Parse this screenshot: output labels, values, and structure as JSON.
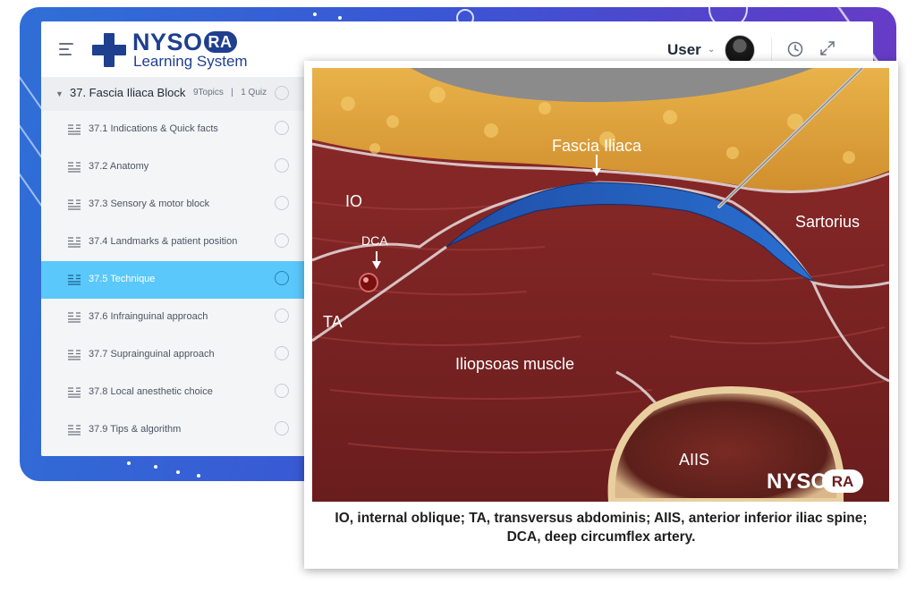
{
  "app": {
    "logo_brand": "NYSO",
    "logo_brand_ra": "RA",
    "logo_subtitle": "Learning System",
    "user_label": "User"
  },
  "sidebar": {
    "section": {
      "title": "37. Fascia Iliaca Block",
      "topics": "9Topics",
      "separator": "|",
      "quiz": "1 Quiz"
    },
    "items": [
      {
        "label": "37.1 Indications & Quick facts",
        "active": false
      },
      {
        "label": "37.2 Anatomy",
        "active": false
      },
      {
        "label": "37.3 Sensory & motor block",
        "active": false
      },
      {
        "label": "37.4 Landmarks & patient position",
        "active": false
      },
      {
        "label": "37.5 Technique",
        "active": true
      },
      {
        "label": "37.6 Infrainguinal approach",
        "active": false
      },
      {
        "label": "37.7 Suprainguinal approach",
        "active": false
      },
      {
        "label": "37.8 Local anesthetic choice",
        "active": false
      },
      {
        "label": "37.9 Tips & algorithm",
        "active": false
      }
    ]
  },
  "figure": {
    "labels": {
      "fascia_iliaca": "Fascia Iliaca",
      "io": "IO",
      "dca": "DCA",
      "ta": "TA",
      "sartorius": "Sartorius",
      "iliopsoas": "Iliopsoas muscle",
      "aiis": "AIIS",
      "watermark_brand": "NYSO",
      "watermark_ra": "RA"
    },
    "caption": "IO, internal oblique; TA, transversus abdominis; AIIS, anterior inferior iliac spine; DCA, deep circumflex artery."
  },
  "colors": {
    "brand": "#1f3f8f",
    "active_item": "#5ac8fa",
    "backdrop_start": "#2f6fd6",
    "backdrop_end": "#6f3ac6"
  },
  "icons": {
    "menu": "hamburger-icon",
    "clock": "clock-icon",
    "expand": "expand-icon",
    "topic": "list-lines-icon"
  }
}
